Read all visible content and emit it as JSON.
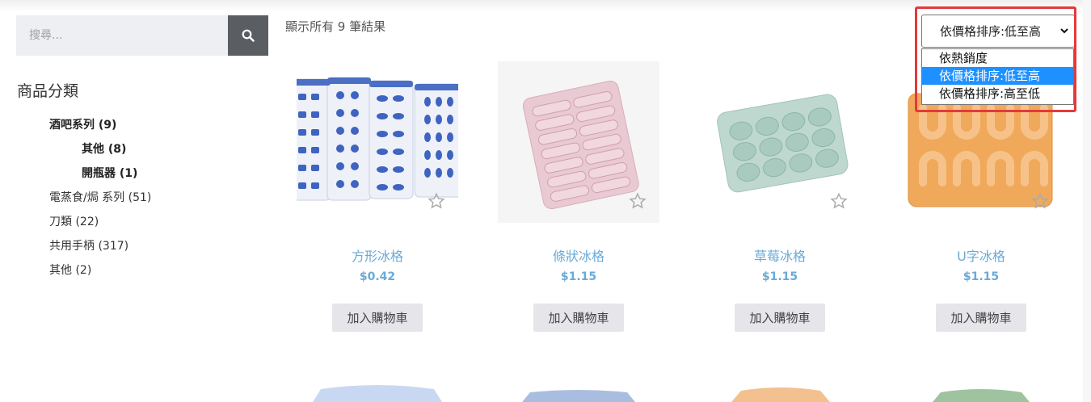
{
  "search": {
    "placeholder": "搜尋..."
  },
  "sidebar": {
    "title": "商品分類",
    "categories": [
      {
        "label": "酒吧系列",
        "count": "(9)"
      },
      {
        "label": "其他",
        "count": "(8)"
      },
      {
        "label": "開瓶器",
        "count": "(1)"
      },
      {
        "label": "電蒸食/焗 系列",
        "count": "(51)"
      },
      {
        "label": "刀類",
        "count": "(22)"
      },
      {
        "label": "共用手柄",
        "count": "(317)"
      },
      {
        "label": "其他",
        "count": "(2)"
      }
    ]
  },
  "results": {
    "count_text": "顯示所有 9 筆結果"
  },
  "sort": {
    "selected": "依價格排序:低至高",
    "options": [
      "依熱銷度",
      "依價格排序:低至高",
      "依價格排序:高至低"
    ],
    "highlight_color": "#1e90ff",
    "outline_color": "#e23a3a"
  },
  "products": [
    {
      "name": "方形冰格",
      "price": "$0.42",
      "add_label": "加入購物車"
    },
    {
      "name": "條狀冰格",
      "price": "$1.15",
      "add_label": "加入購物車"
    },
    {
      "name": "草莓冰格",
      "price": "$1.15",
      "add_label": "加入購物車"
    },
    {
      "name": "U字冰格",
      "price": "$1.15",
      "add_label": "加入購物車"
    }
  ],
  "colors": {
    "link": "#6aaad8",
    "search_button": "#5a5e63"
  }
}
